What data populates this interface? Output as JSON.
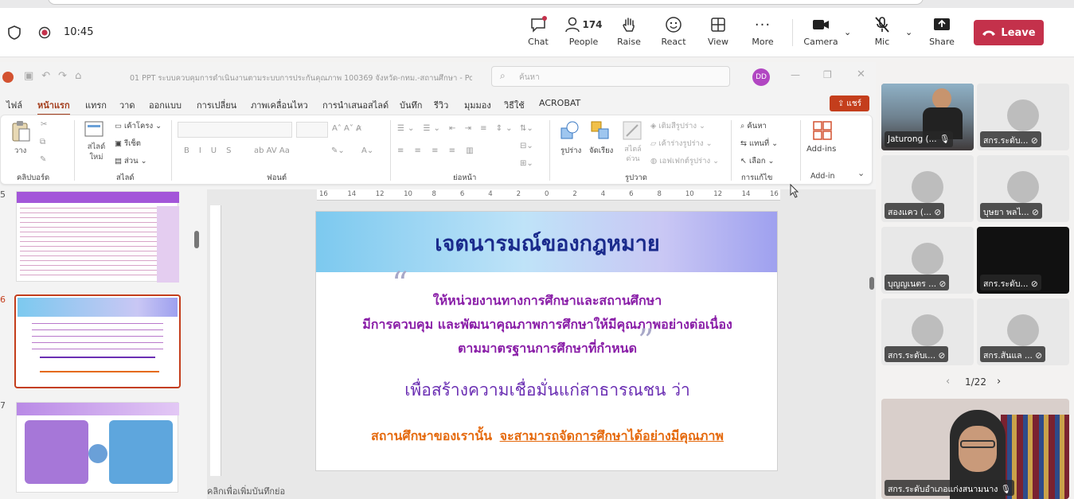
{
  "meeting": {
    "time": "10:45",
    "chat_label": "Chat",
    "people_count": "174",
    "people_label": "People",
    "raise_label": "Raise",
    "react_label": "React",
    "view_label": "View",
    "more_label": "More",
    "camera_label": "Camera",
    "mic_label": "Mic",
    "share_label": "Share",
    "leave_label": "Leave"
  },
  "ppt": {
    "title": "01 PPT ระบบควบคุมการดำเนินงานตามระบบการประกันคุณภาพ 100369 จังหวัด-กทม.-สถานศึกษา - PowerP...",
    "search_placeholder": "ค้นหา",
    "user_initials": "DD",
    "share_label": "แชร์",
    "tabs": [
      "ไฟล์",
      "หน้าแรก",
      "แทรก",
      "วาด",
      "ออกแบบ",
      "การเปลี่ยน",
      "ภาพเคลื่อนไหว",
      "การนำเสนอสไลด์",
      "บันทึก",
      "รีวิว",
      "มุมมอง",
      "วิธีใช้",
      "ACROBAT"
    ],
    "groups": [
      "คลิปบอร์ด",
      "สไลด์",
      "ฟอนต์",
      "ย่อหน้า",
      "รูปวาด",
      "การแก้ไข",
      "Add-in"
    ],
    "btn_paste": "วาง",
    "btn_new_slide": "สไลด์ใหม่",
    "btn_layout": "เค้าโครง",
    "btn_reset": "รีเซ็ต",
    "btn_section": "ส่วน",
    "btn_shapes": "รูปร่าง",
    "btn_arrange": "จัดเรียง",
    "btn_quick_styles": "สไตล์ด่วน",
    "btn_shape_fill": "เติมสีรูปร่าง",
    "btn_shape_outline": "เค้าร่างรูปร่าง",
    "btn_shape_effects": "เอฟเฟกต์รูปร่าง",
    "btn_find": "ค้นหา",
    "btn_replace": "แทนที่",
    "btn_select": "เลือก",
    "btn_addins": "Add-ins",
    "thumb_numbers": [
      "5",
      "6",
      "7"
    ],
    "notes_placeholder": "คลิกเพื่อเพิ่มบันทึกย่อ",
    "ruler_labels": [
      "16",
      "14",
      "12",
      "10",
      "8",
      "6",
      "4",
      "2",
      "0",
      "2",
      "4",
      "6",
      "8",
      "10",
      "12",
      "14",
      "16"
    ]
  },
  "slide": {
    "title": "เจตนารมณ์ของกฎหมาย",
    "line1": "ให้หน่วยงานทางการศึกษาและสถานศึกษา",
    "line2": "มีการควบคุม และพัฒนาคุณภาพการศึกษาให้มีคุณภาพอย่างต่อเนื่อง",
    "line3": "ตามมาตรฐานการศึกษาที่กำหนด",
    "line4": "เพื่อสร้างความเชื่อมั่นแก่สาธารณชน  ว่า",
    "line5_a": "สถานศึกษาของเรานั้น",
    "line5_b": "จะสามารถจัดการศึกษาได้อย่างมีคุณภาพ"
  },
  "participants": [
    {
      "name": "Jaturong (..."
    },
    {
      "name": "สกร.ระดับ..."
    },
    {
      "name": "สองแคว (..."
    },
    {
      "name": "บุษยา พลไ..."
    },
    {
      "name": "บุญญเนตร ..."
    },
    {
      "name": "สกร.ระดับ..."
    },
    {
      "name": "สกร.ระดับเ..."
    },
    {
      "name": "สกร.สันแล ..."
    }
  ],
  "pagination": "1/22",
  "self_view_name": "สกร.ระดับอำเภอแก่งสนามนาง",
  "colors": {
    "leave": "#c4314b",
    "slide_title": "#1a2a8c",
    "slide_purple": "#8a1fa8",
    "slide_orange": "#e56a0e",
    "tab_active": "#a33d1c"
  }
}
